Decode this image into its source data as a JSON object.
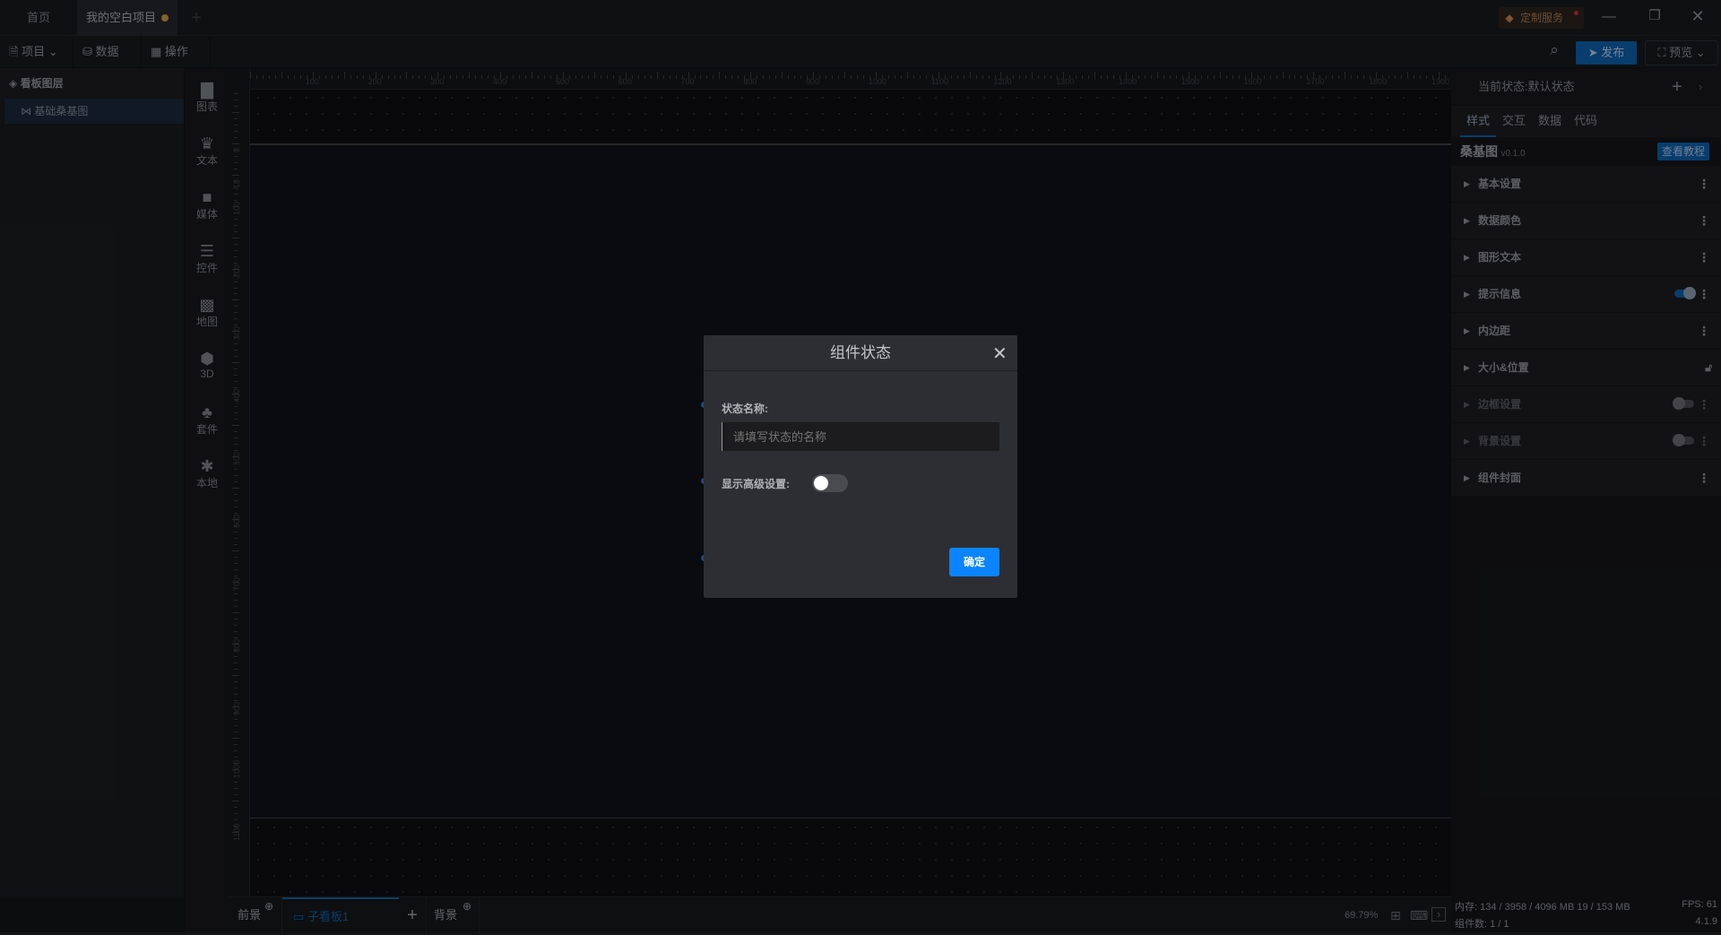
{
  "tabs": [
    {
      "label": "首页"
    },
    {
      "label": "我的空白项目",
      "unsaved": true
    }
  ],
  "new_tab": "+",
  "custom_service": "定制服务",
  "toolbar": {
    "project": "项目",
    "data": "数据",
    "operate": "操作",
    "publish": "发布",
    "preview": "预览"
  },
  "layers": {
    "title": "看板图层",
    "items": [
      {
        "label": "基础桑基图",
        "selected": true
      }
    ]
  },
  "component_types": [
    "图表",
    "文本",
    "媒体",
    "控件",
    "地图",
    "3D",
    "套件",
    "本地"
  ],
  "ruler": {
    "h": [
      "0",
      "100",
      "200",
      "300",
      "400",
      "500",
      "600",
      "700",
      "800",
      "900",
      "1000",
      "1100",
      "1200",
      "1300",
      "1400",
      "1500",
      "1600",
      "1700",
      "1800",
      "1900"
    ],
    "v": [
      "-10",
      "0",
      "100",
      "200",
      "300",
      "400",
      "500",
      "600",
      "700",
      "800",
      "900",
      "1000",
      "1100"
    ]
  },
  "right": {
    "state_label": "当前状态:",
    "state_value": "默认状态",
    "tabs": [
      "样式",
      "交互",
      "数据",
      "代码"
    ],
    "active_tab": 0,
    "component": "桑基图",
    "version": "v0.1.0",
    "tutorial": "查看教程",
    "sections": [
      {
        "label": "基本设置",
        "ctrl": "menu"
      },
      {
        "label": "数据颜色",
        "ctrl": "menu"
      },
      {
        "label": "图形文本",
        "ctrl": "menu"
      },
      {
        "label": "提示信息",
        "ctrl": "toggle-on"
      },
      {
        "label": "内边距",
        "ctrl": "menu"
      },
      {
        "label": "大小&位置",
        "ctrl": "lock"
      },
      {
        "label": "边框设置",
        "ctrl": "toggle-off",
        "disabled": true
      },
      {
        "label": "背景设置",
        "ctrl": "toggle-off",
        "disabled": true
      },
      {
        "label": "组件封面",
        "ctrl": "menu"
      }
    ]
  },
  "bottom": {
    "foreground": "前景",
    "board": "子看板1",
    "add": "+",
    "background": "背景",
    "zoom": "69.79%"
  },
  "status": {
    "memory": "内存: 134 / 3958 / 4096 MB  19 / 153 MB",
    "fps": "FPS: 61",
    "components": "组件数: 1 / 1",
    "version": "4.1.9"
  },
  "dialog": {
    "title": "组件状态",
    "name_label": "状态名称:",
    "name_placeholder": "请填写状态的名称",
    "name_value": "",
    "advanced_label": "显示高级设置:",
    "advanced_on": false,
    "confirm": "确定"
  },
  "colors": {
    "accent": "#0a84ff",
    "brand_blue": "#0d5ea8",
    "unsaved_dot": "#c89a3c"
  }
}
